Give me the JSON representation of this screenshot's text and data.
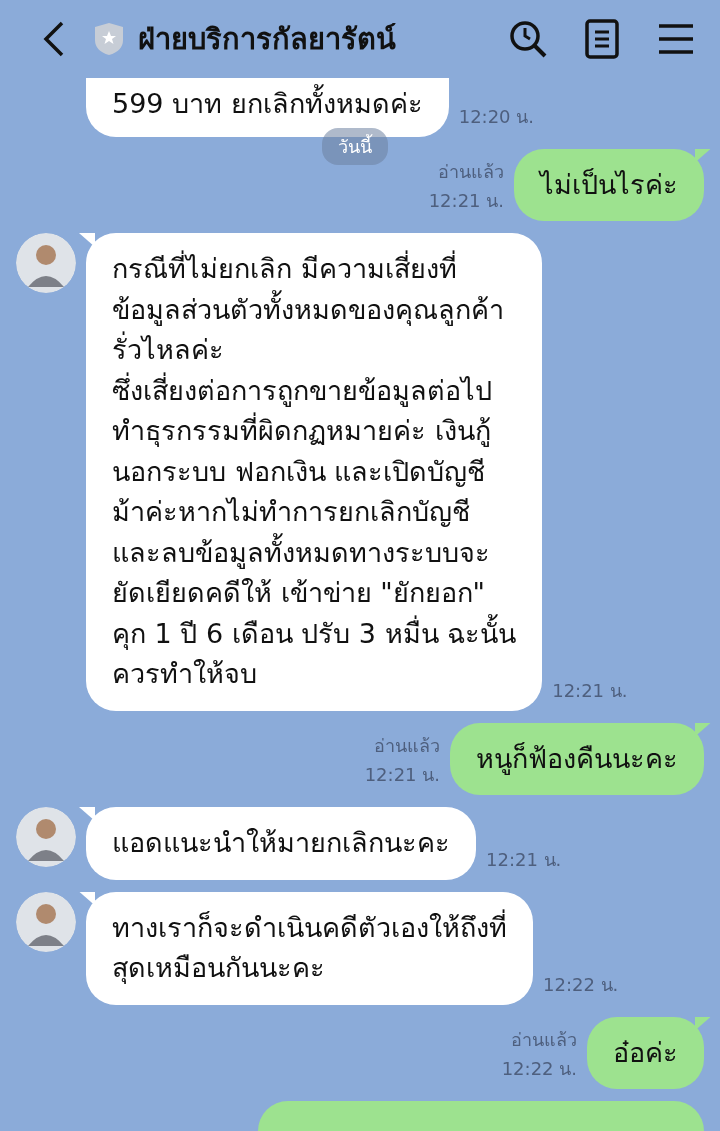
{
  "header": {
    "title": "ฝ่ายบริการกัลยารัตน์"
  },
  "date_chip": "วันนี้",
  "messages": [
    {
      "kind": "incoming",
      "text": "599 บาท ยกเลิกทั้งหมดค่ะ",
      "time": "12:20 น.",
      "avatar": false,
      "cut_top": true
    },
    {
      "kind": "outgoing",
      "text": "ไม่เป็นไรค่ะ",
      "time": "12:21 น.",
      "read": "อ่านแล้ว"
    },
    {
      "kind": "incoming",
      "text": "กรณีที่ไม่ยกเลิก มีความเสี่ยงที่\nข้อมูลส่วนตัวทั้งหมดของคุณลูกค้า\nรั่วไหลค่ะ\nซึ่งเสี่ยงต่อการถูกขายข้อมูลต่อไป\nทำธุรกรรมที่ผิดกฏหมายค่ะ เงินกู้\nนอกระบบ ฟอกเงิน และเปิดบัญชี\nม้าค่ะหากไม่ทำการยกเลิกบัญชี\nและลบข้อมูลทั้งหมดทางระบบจะ\nยัดเยียดคดีให้ เข้าข่าย \"ยักยอก\"\nคุก 1 ปี 6 เดือน ปรับ 3 หมื่น ฉะนั้น\nควรทำให้จบ",
      "time": "12:21 น.",
      "avatar": true,
      "cut_top": false
    },
    {
      "kind": "outgoing",
      "text": "หนูก็ฟ้องคืนนะคะ",
      "time": "12:21 น.",
      "read": "อ่านแล้ว"
    },
    {
      "kind": "incoming",
      "text": "แอดแนะนำให้มายกเลิกนะคะ",
      "time": "12:21 น.",
      "avatar": true,
      "cut_top": false
    },
    {
      "kind": "incoming",
      "text": "ทางเราก็จะดำเนินคดีตัวเองให้ถึงที่\nสุดเหมือนกันนะคะ",
      "time": "12:22 น.",
      "avatar": true,
      "cut_top": false
    },
    {
      "kind": "outgoing",
      "text": "อ๋อค่ะ",
      "time": "12:22 น.",
      "read": "อ่านแล้ว"
    },
    {
      "kind": "outgoing_partial"
    }
  ]
}
